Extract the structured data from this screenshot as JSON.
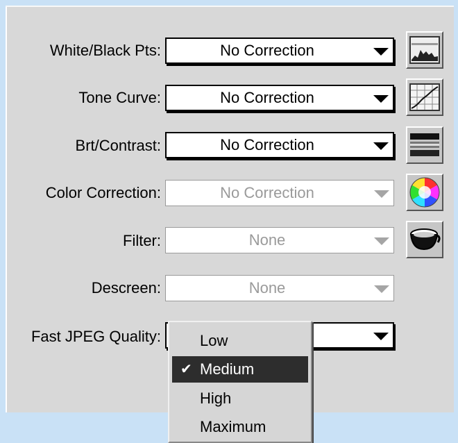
{
  "rows": [
    {
      "label": "White/Black Pts:",
      "value": "No Correction",
      "enabled": true
    },
    {
      "label": "Tone Curve:",
      "value": "No Correction",
      "enabled": true
    },
    {
      "label": "Brt/Contrast:",
      "value": "No Correction",
      "enabled": true
    },
    {
      "label": "Color Correction:",
      "value": "No Correction",
      "enabled": false
    },
    {
      "label": "Filter:",
      "value": "None",
      "enabled": false
    },
    {
      "label": "Descreen:",
      "value": "None",
      "enabled": false
    },
    {
      "label": "Fast JPEG Quality:",
      "value": "",
      "enabled": true
    }
  ],
  "tool_buttons": [
    {
      "icon": "histogram-icon"
    },
    {
      "icon": "tone-curve-icon"
    },
    {
      "icon": "brightness-contrast-icon"
    },
    {
      "icon": "color-wheel-icon"
    },
    {
      "icon": "filter-cup-icon"
    }
  ],
  "jpeg_quality_menu": {
    "options": [
      "Low",
      "Medium",
      "High",
      "Maximum"
    ],
    "selected": "Medium",
    "check_glyph": "✔"
  },
  "colors": {
    "background": "#c9e1f6",
    "panel": "#d8d8d8",
    "selection": "#2d2d2d",
    "disabled_text": "#9a9a9a"
  }
}
